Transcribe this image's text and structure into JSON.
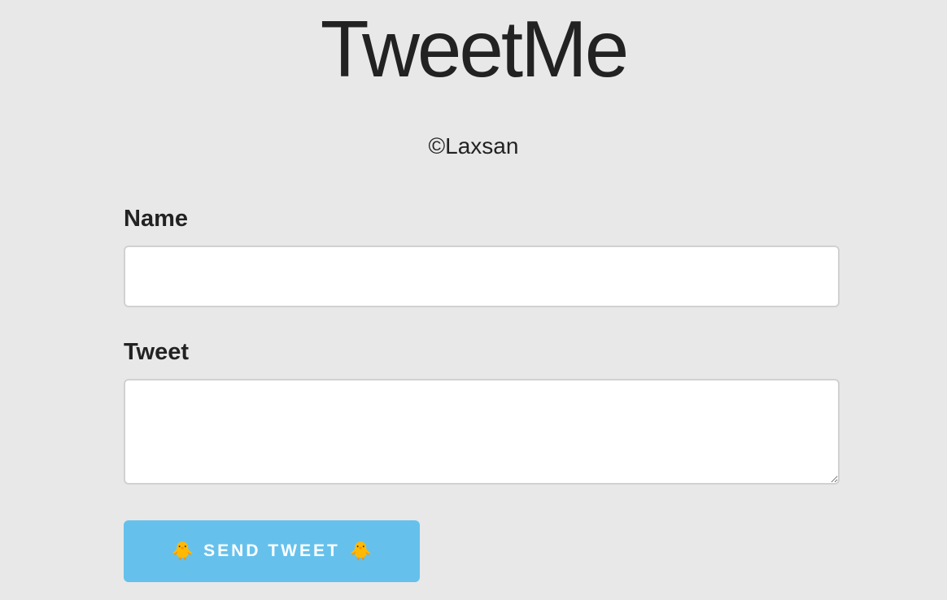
{
  "app": {
    "title": "TweetMe",
    "copyright": "©Laxsan"
  },
  "form": {
    "name_label": "Name",
    "name_value": "",
    "name_placeholder": "",
    "tweet_label": "Tweet",
    "tweet_value": "",
    "tweet_placeholder": ""
  },
  "button": {
    "label": "SEND TWEET",
    "icon_left": "🐥",
    "icon_right": "🐥",
    "color": "#65c1ec"
  },
  "colors": {
    "background": "#e8e8e8",
    "text": "#222222",
    "input_background": "#ffffff",
    "input_border": "#d1d1d1"
  }
}
